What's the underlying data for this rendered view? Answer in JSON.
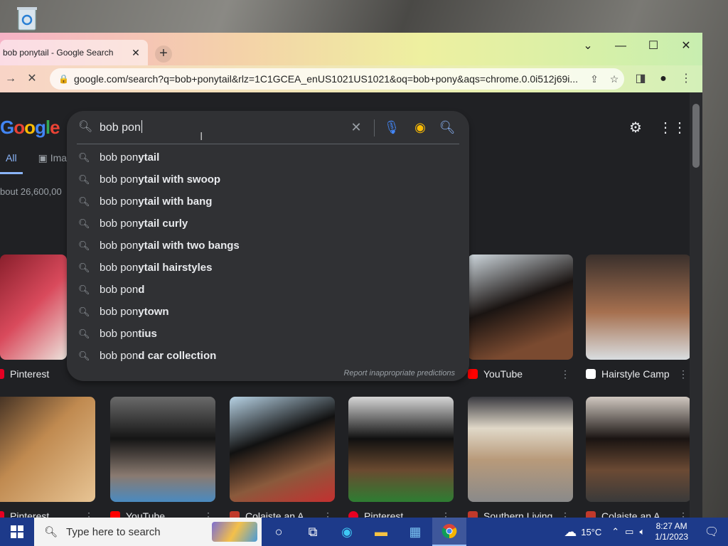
{
  "colors": {
    "accent": "#8ab4f8",
    "page_bg": "#202124",
    "popup_bg": "#303134",
    "taskbar": "#1d3a8a"
  },
  "browser": {
    "tab_title": "bob ponytail - Google Search",
    "new_tab_icon": "plus-icon",
    "url": "google.com/search?q=bob+ponytail&rlz=1C1GCEA_enUS1021US1021&oq=bob+pony&aqs=chrome.0.0i512j69i..."
  },
  "google": {
    "logo_text": "Google",
    "nav_tabs": [
      {
        "label": "All"
      },
      {
        "label": "Ima"
      }
    ],
    "result_count": "bout 26,600,00"
  },
  "search": {
    "value": "bob pon",
    "suggestions": [
      {
        "prefix": "bob pon",
        "completion": "ytail"
      },
      {
        "prefix": "bob pon",
        "completion": "ytail with swoop"
      },
      {
        "prefix": "bob pon",
        "completion": "ytail with bang"
      },
      {
        "prefix": "bob pon",
        "completion": "ytail curly"
      },
      {
        "prefix": "bob pon",
        "completion": "ytail with two bangs"
      },
      {
        "prefix": "bob pon",
        "completion": "ytail hairstyles"
      },
      {
        "prefix": "bob pon",
        "completion": "d"
      },
      {
        "prefix": "bob pon",
        "completion": "ytown"
      },
      {
        "prefix": "bob pon",
        "completion": "tius"
      },
      {
        "prefix": "bob pon",
        "completion": "d car collection"
      }
    ],
    "report_text": "Report inappropriate predictions"
  },
  "images_row1": [
    {
      "source": "Pinterest",
      "fav_color": "#e60023"
    },
    {
      "source": "YouTube",
      "fav_color": "#ff0000"
    },
    {
      "source": "Hairstyle Camp",
      "fav_color": "#ffffff"
    }
  ],
  "images_row2": [
    {
      "source": "Pinterest",
      "fav_color": "#e60023"
    },
    {
      "source": "YouTube",
      "fav_color": "#ff0000"
    },
    {
      "source": "Colaiste an A...",
      "fav_color": "#c0392b"
    },
    {
      "source": "Pinterest",
      "fav_color": "#e60023"
    },
    {
      "source": "Southern Living",
      "fav_color": "#c0392b"
    },
    {
      "source": "Colaiste an A...",
      "fav_color": "#c0392b"
    }
  ],
  "taskbar": {
    "search_placeholder": "Type here to search",
    "weather": "15°C",
    "time": "8:27 AM",
    "date": "1/1/2023"
  }
}
